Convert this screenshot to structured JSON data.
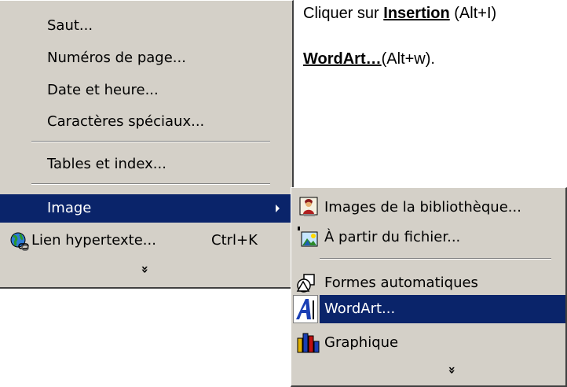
{
  "instructions": {
    "line1_prefix": "Cliquer sur ",
    "insertion": "Insertion",
    "line1_suffix": " (Alt+I)",
    "wordart": "WordArt…",
    "line2_suffix": "(Alt+w)."
  },
  "insert_menu": {
    "items": [
      {
        "label": "Saut..."
      },
      {
        "label": "Numéros de page..."
      },
      {
        "label": "Date et heure..."
      },
      {
        "label": "Caractères spéciaux..."
      },
      {
        "label": "Tables et index..."
      },
      {
        "label": "Image"
      },
      {
        "label": "Lien hypertexte...",
        "shortcut": "Ctrl+K",
        "icon": "globe-link-icon"
      }
    ],
    "expand_glyph": "»"
  },
  "image_menu": {
    "items": [
      {
        "label": "Images de la bibliothèque...",
        "icon": "clipart-icon"
      },
      {
        "label": "À partir du fichier...",
        "icon": "picture-file-icon"
      },
      {
        "label": "Formes automatiques",
        "icon": "autoshapes-icon"
      },
      {
        "label": "WordArt...",
        "icon": "wordart-icon"
      },
      {
        "label": "Graphique",
        "icon": "chart-icon"
      }
    ],
    "expand_glyph": "»"
  },
  "colors": {
    "menu_bg": "#d4d0c8",
    "highlight": "#0a246a"
  }
}
